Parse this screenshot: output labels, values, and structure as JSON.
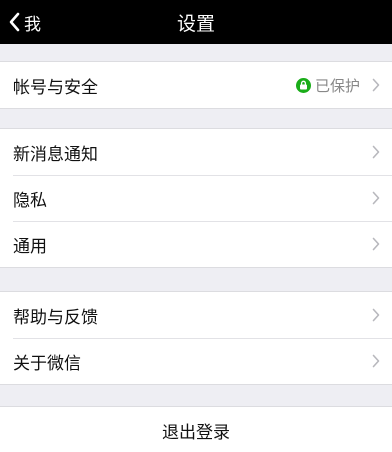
{
  "navbar": {
    "back_label": "我",
    "title": "设置"
  },
  "account_group": {
    "items": [
      {
        "label": "帐号与安全",
        "status": "已保护",
        "status_color": "#1aad19"
      }
    ]
  },
  "notification_group": {
    "items": [
      {
        "label": "新消息通知"
      },
      {
        "label": "隐私"
      },
      {
        "label": "通用"
      }
    ]
  },
  "help_group": {
    "items": [
      {
        "label": "帮助与反馈"
      },
      {
        "label": "关于微信"
      }
    ]
  },
  "logout": {
    "label": "退出登录"
  },
  "icons": {
    "back": "chevron-left-icon",
    "row_arrow": "chevron-right-icon",
    "lock": "lock-icon"
  }
}
